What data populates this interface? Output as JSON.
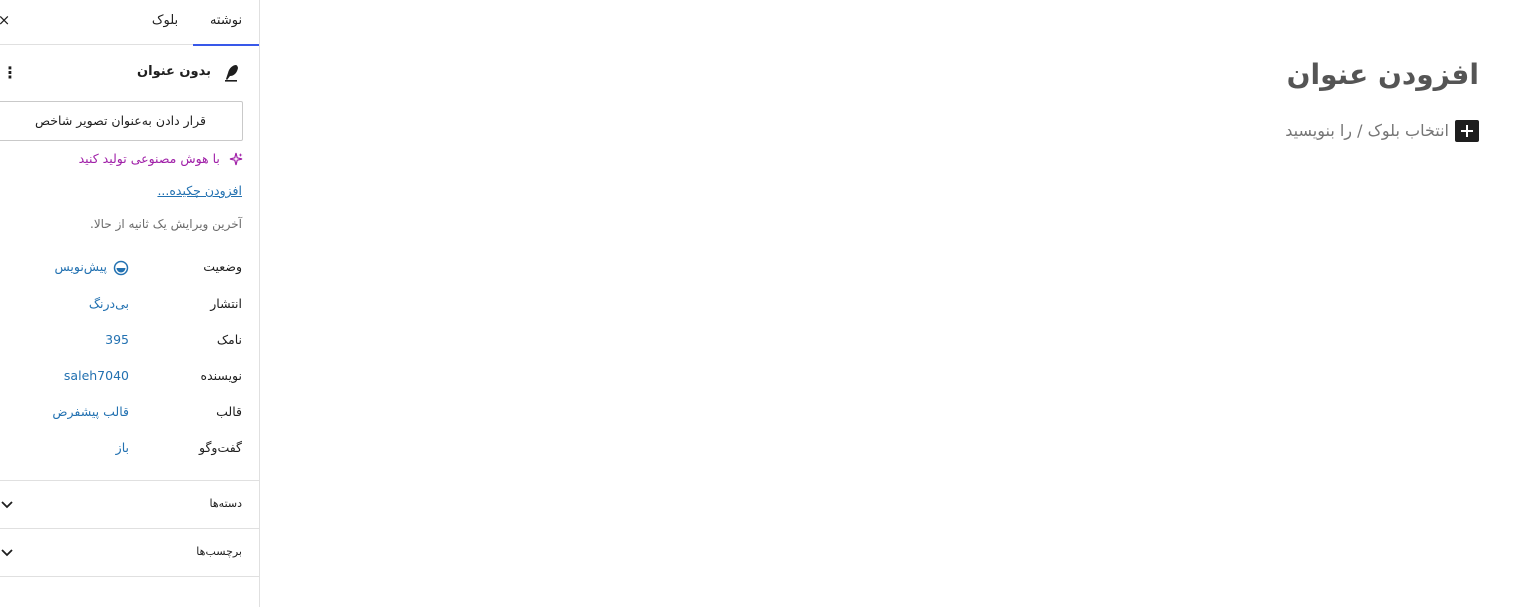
{
  "sidebar": {
    "close_icon": "×",
    "kebab_icon": "⋮",
    "tabs": [
      {
        "label": "نوشته",
        "active": true
      },
      {
        "label": "بلوک",
        "active": false
      }
    ],
    "post_title": "بدون عنوان",
    "featured_image_button": "قرار دادن به‌عنوان تصویر شاخص",
    "ai_generate": "با هوش مصنوعی تولید کنید",
    "add_excerpt": "افزودن چکیده...",
    "last_edited": "آخرین ویرایش یک ثانیه از حالا.",
    "meta": [
      {
        "label": "وضعیت",
        "value": "پیش‌نویس"
      },
      {
        "label": "انتشار",
        "value": "بی‌درنگ"
      },
      {
        "label": "نامک",
        "value": "395"
      },
      {
        "label": "نویسنده",
        "value": "saleh7040"
      },
      {
        "label": "قالب",
        "value": "قالب پیشفرض"
      },
      {
        "label": "گفت‌وگو",
        "value": "باز"
      }
    ],
    "panels": [
      {
        "title": "دسته‌ها"
      },
      {
        "title": "برچسب‌ها"
      }
    ]
  },
  "editor": {
    "title_placeholder": "افزودن عنوان",
    "block_placeholder": "انتخاب بلوک / را بنویسید"
  },
  "colors": {
    "accent": "#3858e9",
    "link": "#2271b1",
    "ai": "#a020a8",
    "title": "#555555"
  }
}
